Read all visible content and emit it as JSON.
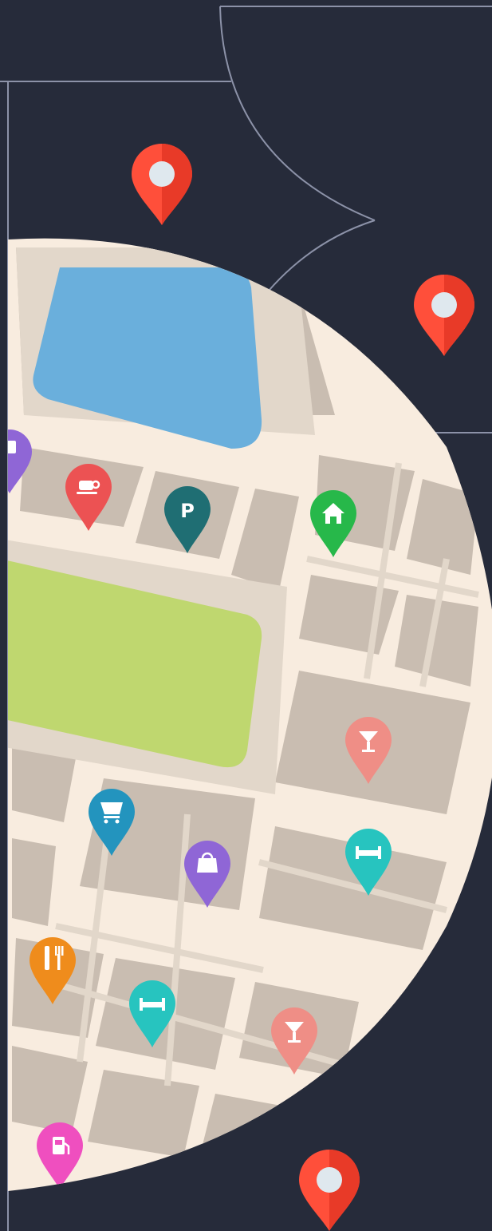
{
  "colors": {
    "background": "#262b3a",
    "outline": "#8c92a8",
    "map_block": "#c9bdb1",
    "map_road": "#f8ecdf",
    "map_plaza": "#e2d7ca",
    "water": "#6aafdc",
    "park": "#bfd76f",
    "location_pin": "#ff4f3a"
  },
  "pins": {
    "shopping_1": {
      "icon": "shopping-bag-icon",
      "color": "#8f66d6"
    },
    "cafe": {
      "icon": "coffee-cup-icon",
      "color": "#ec5253"
    },
    "parking": {
      "icon": "parking-icon",
      "color": "#1f6e73",
      "label": "P"
    },
    "home": {
      "icon": "home-icon",
      "color": "#27b84a"
    },
    "bar_1": {
      "icon": "cocktail-glass-icon",
      "color": "#ef8e86"
    },
    "cart": {
      "icon": "shopping-cart-icon",
      "color": "#2394be"
    },
    "hotel_1": {
      "icon": "bed-icon",
      "color": "#27c4bf"
    },
    "shopping_2": {
      "icon": "shopping-bag-icon",
      "color": "#8f66d6"
    },
    "restaurant": {
      "icon": "fork-knife-icon",
      "color": "#ef8c1c"
    },
    "hotel_2": {
      "icon": "bed-icon",
      "color": "#27c4bf"
    },
    "bar_2": {
      "icon": "cocktail-glass-icon",
      "color": "#ef8e86"
    },
    "fuel": {
      "icon": "fuel-pump-icon",
      "color": "#ef4fbf"
    }
  },
  "location_markers": [
    "location-pin-icon",
    "location-pin-icon",
    "location-pin-icon"
  ]
}
